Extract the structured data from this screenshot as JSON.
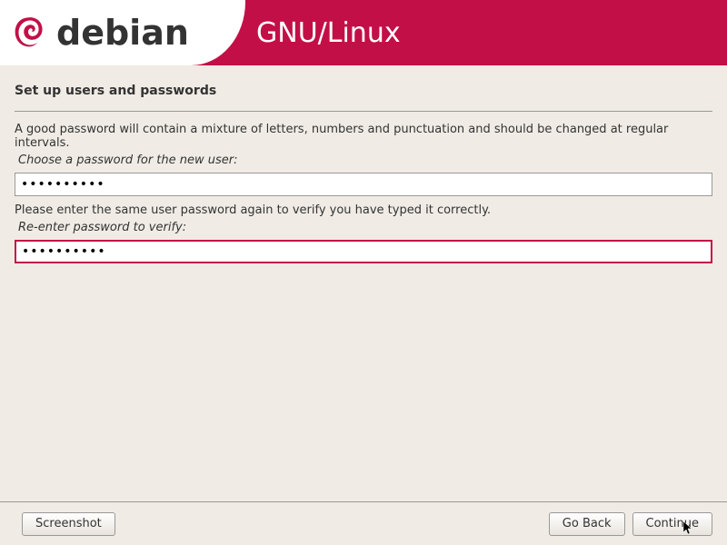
{
  "header": {
    "logo_text": "debian",
    "title": "GNU/Linux"
  },
  "page": {
    "title": "Set up users and passwords",
    "info_text": "A good password will contain a mixture of letters, numbers and punctuation and should be changed at regular intervals.",
    "choose_label": "Choose a password for the new user:",
    "verify_info": "Please enter the same user password again to verify you have typed it correctly.",
    "reenter_label": "Re-enter password to verify:",
    "password_value": "••••••••••",
    "password_verify_value": "••••••••••"
  },
  "buttons": {
    "screenshot": "Screenshot",
    "go_back": "Go Back",
    "continue": "Continue"
  }
}
